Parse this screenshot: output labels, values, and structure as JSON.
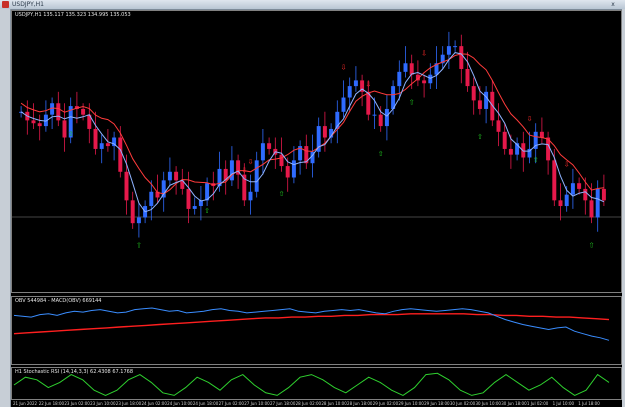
{
  "window": {
    "title": "USDJPY,H1",
    "close_glyph": "x"
  },
  "main_chart": {
    "label": "USDJPY,H1  135.117 135.323 134.995 135.053",
    "colors": {
      "up_candle": "#2f6bff",
      "down_candle": "#e6194b",
      "ma_fast": "#8fb3ff",
      "ma_slow": "#ff3b3b",
      "up_arrow": "#1fbf1f",
      "down_arrow": "#ff2a2a",
      "hline": "#8a8a8a"
    }
  },
  "obv_pane": {
    "label": "OBV 544984  - MACD(OBV) 669144",
    "colors": {
      "obv": "#3a8dff",
      "signal": "#ff1f1f"
    }
  },
  "stoch_pane": {
    "label": "H1 Stochastic RSI (14,14,3,3) 62.4308 67.1768",
    "colors": {
      "line": "#2fd12f"
    }
  },
  "time_axis": {
    "ticks": [
      "21 Jun 2022",
      "22 Jun 18:00",
      "23 Jun 02:00",
      "23 Jun 10:00",
      "23 Jun 18:00",
      "24 Jun 02:00",
      "24 Jun 10:00",
      "24 Jun 18:00",
      "27 Jun 02:00",
      "27 Jun 10:00",
      "27 Jun 18:00",
      "28 Jun 02:00",
      "28 Jun 10:00",
      "28 Jun 18:00",
      "29 Jun 02:00",
      "29 Jun 10:00",
      "29 Jun 18:00",
      "30 Jun 02:00",
      "30 Jun 10:00",
      "30 Jun 18:00",
      "1 Jul 02:00",
      "1 Jul 10:00",
      "1 Jul 18:00"
    ]
  },
  "chart_data": {
    "type": "candlestick",
    "title": "USDJPY,H1",
    "ohlc_last": {
      "open": 135.117,
      "high": 135.323,
      "low": 134.995,
      "close": 135.053
    },
    "close_series": [
      61,
      58,
      57,
      56,
      60,
      64,
      58,
      52,
      63,
      62,
      60,
      55,
      48,
      50,
      49,
      52,
      40,
      30,
      22,
      24,
      28,
      33,
      31,
      37,
      40,
      37,
      34,
      27,
      28,
      30,
      36,
      35,
      41,
      37,
      44,
      39,
      30,
      33,
      44,
      50,
      48,
      46,
      42,
      38,
      44,
      49,
      43,
      47,
      56,
      52,
      55,
      61,
      66,
      70,
      72,
      68,
      60,
      60,
      56,
      62,
      70,
      75,
      78,
      74,
      72,
      71,
      74,
      78,
      81,
      84,
      84,
      76,
      70,
      65,
      62,
      68,
      58,
      54,
      48,
      46,
      50,
      45,
      48,
      54,
      52,
      44,
      30,
      28,
      32,
      36,
      34,
      30,
      24,
      34,
      30
    ],
    "obv_series": [
      55,
      54,
      53,
      56,
      57,
      55,
      58,
      60,
      59,
      61,
      62,
      60,
      58,
      59,
      62,
      63,
      64,
      62,
      60,
      61,
      58,
      59,
      60,
      62,
      63,
      61,
      60,
      58,
      59,
      60,
      61,
      62,
      63,
      60,
      59,
      58,
      60,
      61,
      62,
      61,
      62,
      60,
      58,
      57,
      60,
      62,
      63,
      62,
      61,
      60,
      61,
      62,
      63,
      62,
      60,
      58,
      54,
      50,
      47,
      44,
      42,
      40,
      38,
      40,
      41,
      36,
      33,
      30,
      28,
      25
    ],
    "obv_signal_series": [
      33,
      34,
      35,
      36,
      37,
      38,
      39,
      40,
      41,
      42,
      43,
      44,
      45,
      46,
      47,
      48,
      49,
      50,
      51,
      52,
      52,
      53,
      53,
      54,
      54,
      55,
      55,
      56,
      56,
      56,
      57,
      57,
      57,
      57,
      57,
      56,
      56,
      55,
      55,
      54,
      54,
      53,
      53,
      52,
      51,
      50
    ],
    "stoch_series": [
      50,
      80,
      70,
      40,
      60,
      90,
      70,
      30,
      10,
      30,
      70,
      90,
      60,
      20,
      10,
      40,
      80,
      60,
      30,
      70,
      90,
      50,
      20,
      10,
      40,
      80,
      90,
      70,
      40,
      20,
      50,
      80,
      60,
      30,
      10,
      40,
      90,
      95,
      70,
      30,
      10,
      20,
      60,
      90,
      60,
      30,
      50,
      80,
      40,
      10,
      30,
      90,
      60
    ]
  }
}
